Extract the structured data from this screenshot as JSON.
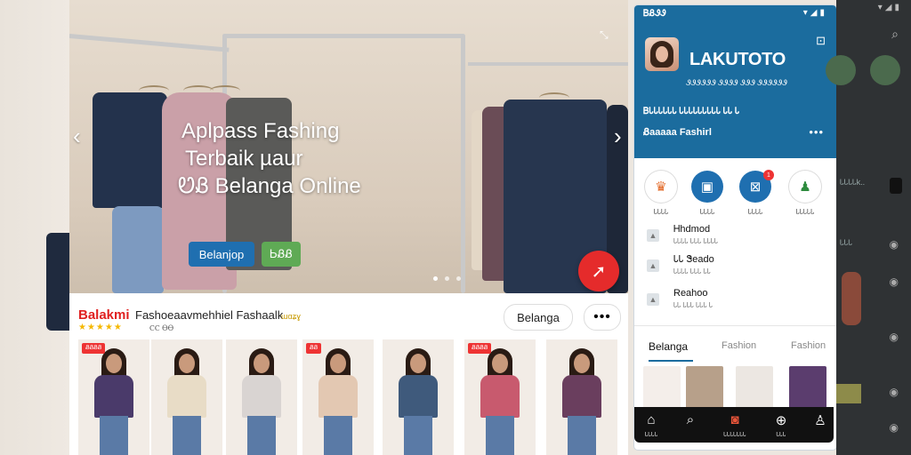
{
  "hero": {
    "title_line1": "Aplpass Fashing",
    "title_line2": "Terbaik µaur",
    "title_line3": "ᏬᏰ Belanga Online",
    "btn_primary": "Belanjop",
    "btn_secondary": "ᏏᏰᏰ",
    "nav_left_icon": "chevron-left-icon",
    "nav_right_icon": "chevron-right-icon",
    "fab_icon": "share-arrow-icon",
    "slides_total": 3,
    "slide_active": 1
  },
  "shop": {
    "logo": "Balakmi",
    "name": "Fashoeaavmehhiel Fashaalk",
    "tag": "ɯɑʑɣ",
    "stars": "★★★★★",
    "rating": "ⲤⲤ ⲐⲐ",
    "belanja_label": "Belanga",
    "more_label": "•••",
    "cards": [
      {
        "badge": "ᏰᏰᏰᏰ",
        "top": "#4a3a6a"
      },
      {
        "badge": "",
        "top": "#e8dcc6"
      },
      {
        "badge": "",
        "top": "#d9d4d2"
      },
      {
        "badge": "ᏰᏰ",
        "top": "#e3c8b2"
      },
      {
        "badge": "",
        "top": "#3f5a7c"
      },
      {
        "badge": "ᏰᏰᏰᏰ",
        "top": "#c85a6e"
      },
      {
        "badge": "",
        "top": "#6a3e5e"
      }
    ]
  },
  "phone": {
    "status_time": "ᏴᏰᏭᏭ",
    "status_icons": "▾◢▮",
    "app_name": "LAKUTOTO",
    "message_icon": "message-icon",
    "subtitle": "ᏭᏭᏭᏭᏭᏭ ᏭᏭᏭᏭ ᏭᏭᏭ ᏭᏭᏭᏭᏭᏭ",
    "info": "ᏴᏓᏓᏓᏓᏓᏓ ᏓᏓᏓᏓᏓᏓᏓᏓᏓ ᏓᏓ Ꮣ",
    "category": "Ᏸaaaaa Fashirl",
    "more": "•••",
    "circles": [
      {
        "icon": "dress-icon",
        "label": "ᏓᏓᏓᏓ",
        "bg": "#ffffff",
        "fg": "#e36b2a"
      },
      {
        "icon": "shirt-icon",
        "label": "ᏓᏓᏓᏓ",
        "bg": "#1f6fb0",
        "fg": "#ffffff"
      },
      {
        "icon": "promo-icon",
        "label": "ᏓᏓᏓᏓ",
        "bg": "#1f6fb0",
        "fg": "#ffffff"
      },
      {
        "icon": "person-icon",
        "label": "ᏓᏓᏓᏓᏓ",
        "bg": "#ffffff",
        "fg": "#2e8b3e"
      }
    ],
    "badge_count": "1",
    "rows": [
      {
        "title": "Ꮋhdmod",
        "sub": "ᏓᏓᏓᏓ ᏓᏓᏓ ᏓᏓᏓᏓ"
      },
      {
        "title": "ᏓᏓ Ꮥeado",
        "sub": "ᏓᏓᏓᏓ ᏓᏓᏓ ᏓᏓ"
      },
      {
        "title": "Reahoo",
        "sub": "ᏓᏓ ᏓᏓᏓ ᏓᏓᏓ Ꮣ"
      }
    ],
    "tabs": [
      "Belanga",
      "Fashion",
      "Fashion"
    ],
    "nav": [
      {
        "icon": "home-icon",
        "label": "ᏓᏓᏓᏓ"
      },
      {
        "icon": "search-icon",
        "label": ""
      },
      {
        "icon": "camera-icon",
        "label": "ᏓᏓᏓᏓᏓᏓᏓ"
      },
      {
        "icon": "bag-icon",
        "label": "ᏓᏓᏓ"
      },
      {
        "icon": "profile-icon",
        "label": ""
      }
    ]
  },
  "right_panel": {
    "status_icons": "▾◢▮",
    "search_icon": "search-icon",
    "text1": "ᏓᏓᏓᏓk..",
    "text2": "ᏓᏓᏓ"
  }
}
